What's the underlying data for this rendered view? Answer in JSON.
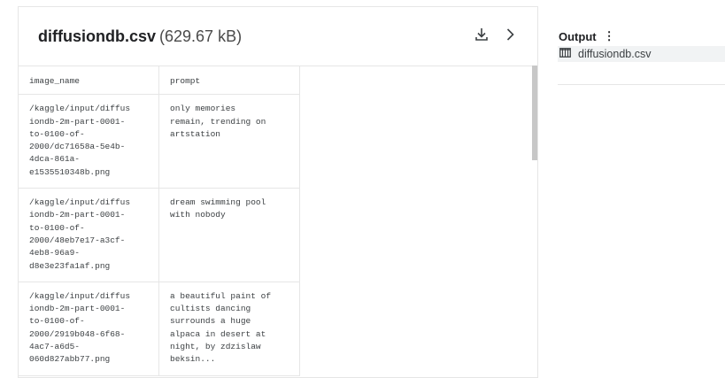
{
  "file": {
    "name": "diffusiondb.csv",
    "size": "(629.67 kB)"
  },
  "table": {
    "columns": [
      "image_name",
      "prompt"
    ],
    "rows": [
      [
        "/kaggle/input/diffusiondb-2m-part-0001-to-0100-of-2000/dc71658a-5e4b-4dca-861a-e1535510348b.png",
        "only memories remain, trending on artstation"
      ],
      [
        "/kaggle/input/diffusiondb-2m-part-0001-to-0100-of-2000/48eb7e17-a3cf-4eb8-96a9-d8e3e23fa1af.png",
        "dream swimming pool with nobody"
      ],
      [
        "/kaggle/input/diffusiondb-2m-part-0001-to-0100-of-2000/2919b048-6f68-4ac7-a6d5-060d827abb77.png",
        "a beautiful paint of cultists dancing surrounds a huge alpaca in desert at night, by zdzislaw beksin..."
      ]
    ]
  },
  "output": {
    "title": "Output",
    "files": [
      "diffusiondb.csv"
    ]
  }
}
